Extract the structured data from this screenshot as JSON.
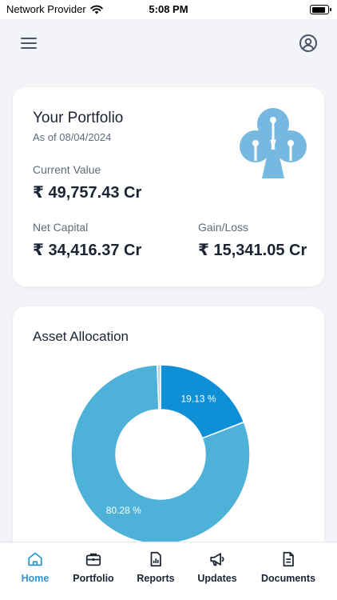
{
  "status_bar": {
    "carrier": "Network Provider",
    "time": "5:08 PM"
  },
  "portfolio": {
    "title": "Your Portfolio",
    "as_of": "As of 08/04/2024",
    "current_value_label": "Current Value",
    "current_value": "₹ 49,757.43 Cr",
    "net_capital_label": "Net Capital",
    "net_capital": "₹ 34,416.37 Cr",
    "gain_loss_label": "Gain/Loss",
    "gain_loss": "₹ 15,341.05 Cr"
  },
  "allocation": {
    "title": "Asset Allocation"
  },
  "chart_data": {
    "type": "pie",
    "donut": true,
    "series": [
      {
        "label": "19.13 %",
        "value": 19.13,
        "color": "#0f8fd6"
      },
      {
        "label": "80.28 %",
        "value": 80.28,
        "color": "#4db1d8"
      },
      {
        "label": "",
        "value": 0.59,
        "color": "#a9d6ea"
      }
    ]
  },
  "nav": {
    "items": [
      {
        "label": "Home",
        "icon": "home-icon",
        "active": true
      },
      {
        "label": "Portfolio",
        "icon": "briefcase-icon",
        "active": false
      },
      {
        "label": "Reports",
        "icon": "report-icon",
        "active": false
      },
      {
        "label": "Updates",
        "icon": "megaphone-icon",
        "active": false
      },
      {
        "label": "Documents",
        "icon": "document-icon",
        "active": false
      }
    ]
  },
  "colors": {
    "accent": "#2996d4",
    "text": "#1c2434",
    "muted": "#5f6b7a",
    "background": "#f2f4f7"
  }
}
